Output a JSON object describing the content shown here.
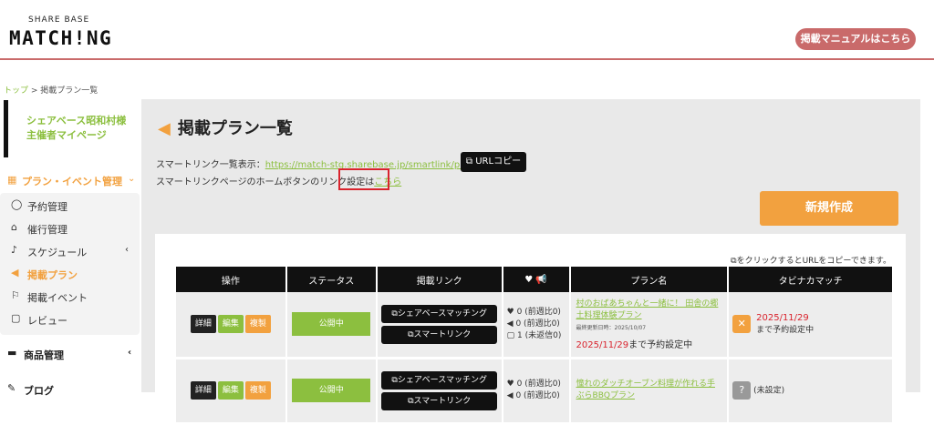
{
  "header": {
    "logo_small": "SHARE BASE",
    "logo_big": "MATCH!NG",
    "manual_button": "掲載マニュアルはこちら"
  },
  "breadcrumb": {
    "home": "トップ",
    "sep": " > ",
    "current": "掲載プラン一覧"
  },
  "sidebar": {
    "title_line1": "シェアベース昭和村様",
    "title_line2": "主催者マイページ",
    "section_label": "プラン・イベント管理",
    "items": [
      {
        "label": "予約管理",
        "icon": "speech-bubble-icon"
      },
      {
        "label": "催行管理",
        "icon": "store-icon"
      },
      {
        "label": "スケジュール",
        "icon": "bell-icon"
      },
      {
        "label": "掲載プラン",
        "icon": "megaphone-icon"
      },
      {
        "label": "掲載イベント",
        "icon": "flag-icon"
      },
      {
        "label": "レビュー",
        "icon": "comment-icon"
      }
    ],
    "product_label": "商品管理",
    "blog_label": "ブログ"
  },
  "main": {
    "title": "掲載プラン一覧",
    "smartlink_label": "スマートリンク一覧表示：",
    "smartlink_url": "https://match-stg.sharebase.jp/smartlink/plan/1",
    "url_copy": "URLコピー",
    "home_text": "スマートリンクページのホームボタンのリンク設定は",
    "home_link": "こちら",
    "new_button": "新規作成",
    "copy_hint": "をクリックするとURLをコピーできます。",
    "columns": [
      "操作",
      "ステータス",
      "掲載リンク",
      "♥ 📢",
      "プラン名",
      "タビナカマッチ"
    ],
    "op_buttons": {
      "detail": "詳細",
      "edit": "編集",
      "copy": "複製"
    },
    "link_buttons": {
      "sharebase": "シェアベースマッチング",
      "smart": "スマートリンク"
    },
    "rows": [
      {
        "status": "公開中",
        "stat1": "0 (前週比0)",
        "stat2": "0 (前週比0)",
        "stat3": "1 (未返信0)",
        "plan_name": "村のおばあちゃんと一緒に！ 田舎の郷土料理体験プラン",
        "plan_updated": "最終更新日時：2025/10/07",
        "until_date": "2025/11/29",
        "until_text": "まで予約設定中",
        "tabi_date": "2025/11/29",
        "tabi_text": "まで予約設定中"
      },
      {
        "status": "公開中",
        "stat1": "0 (前週比0)",
        "stat2": "0 (前週比0)",
        "stat3": "",
        "plan_name": "憧れのダッチオーブン料理が作れる手ぶらBBQプラン",
        "plan_updated": "",
        "until_date": "",
        "until_text": "",
        "tabi_date": "",
        "tabi_text": "(未設定)"
      }
    ]
  },
  "colors": {
    "accent_green": "#8cbf3f",
    "accent_orange": "#f2a13f",
    "header_line": "#c96a6a",
    "red": "#d9232d"
  }
}
